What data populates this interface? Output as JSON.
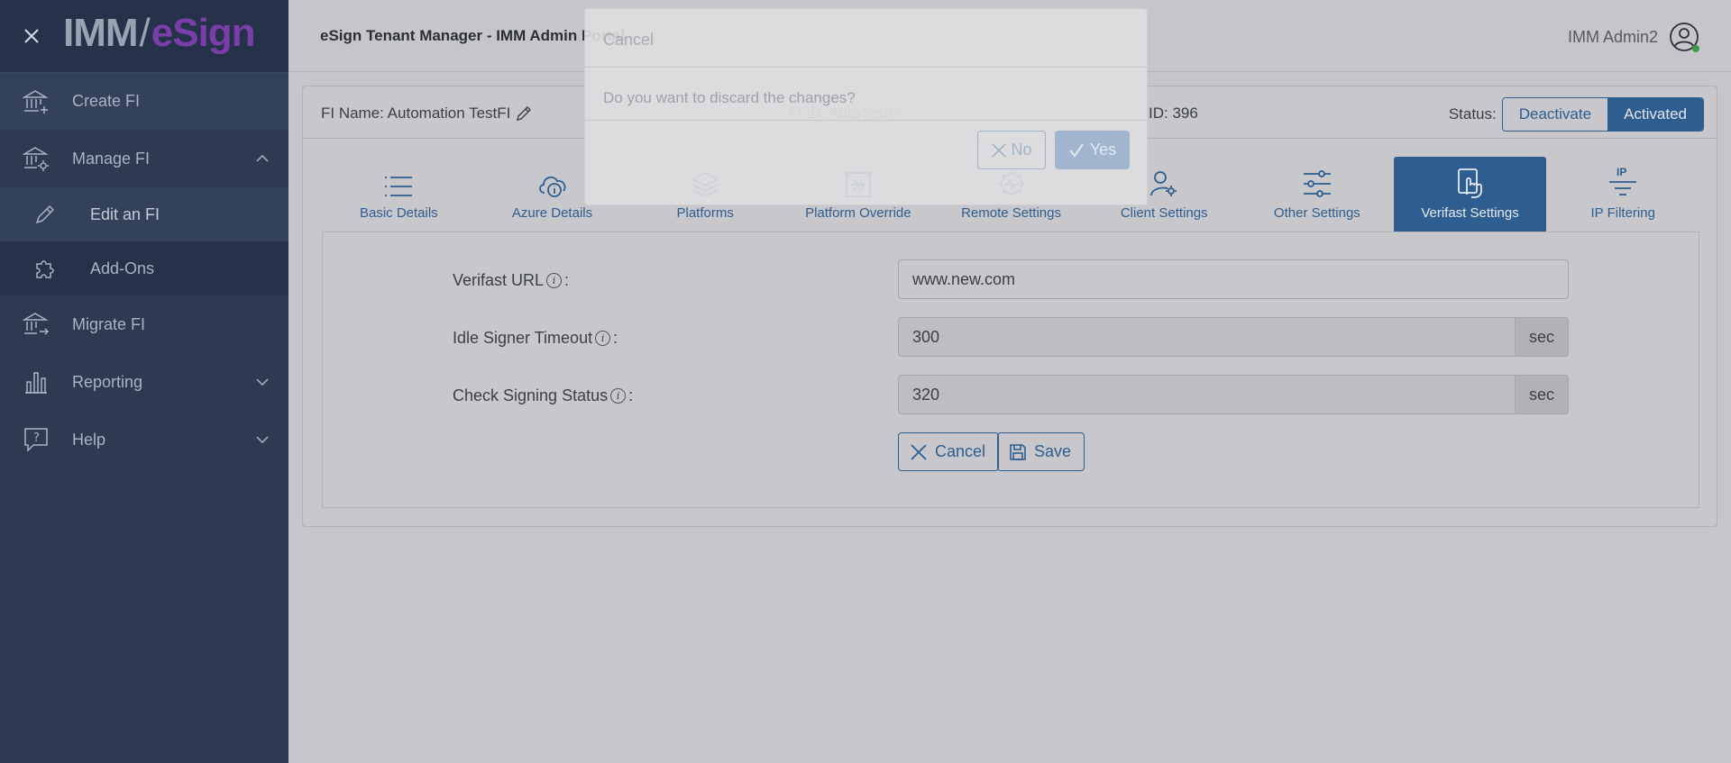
{
  "colors": {
    "sidebar_bg": "#2e3a52",
    "accent": "#2e5d8f",
    "logo_purple": "#7a3ea8"
  },
  "logo": {
    "part1": "IMM",
    "separator": "/",
    "part2": "eSign"
  },
  "sidebar": {
    "items": [
      {
        "label": "Create FI",
        "icon": "bank-plus-icon"
      },
      {
        "label": "Manage FI",
        "icon": "bank-gear-icon"
      },
      {
        "label": "Migrate FI",
        "icon": "bank-arrow-icon"
      },
      {
        "label": "Reporting",
        "icon": "bar-chart-icon"
      },
      {
        "label": "Help",
        "icon": "question-bubble-icon"
      }
    ],
    "sub_items": [
      {
        "label": "Edit an FI",
        "icon": "pencil-icon"
      },
      {
        "label": "Add-Ons",
        "icon": "puzzle-icon"
      }
    ]
  },
  "header": {
    "title": "eSign Tenant Manager - IMM Admin Portal",
    "user": "IMM Admin2"
  },
  "fi": {
    "name": "FI Name: Automation TestFI",
    "id": "FI ID: AutoTestFI",
    "num_id": "ID: 396",
    "status_label": "Status:",
    "deactivate": "Deactivate",
    "activated": "Activated"
  },
  "tabs": [
    {
      "label": "Basic Details",
      "icon": "list-icon"
    },
    {
      "label": "Azure Details",
      "icon": "cloud-info-icon"
    },
    {
      "label": "Platforms",
      "icon": "layers-icon"
    },
    {
      "label": "Platform Override",
      "icon": "arrow-box-icon"
    },
    {
      "label": "Remote Settings",
      "icon": "gear-pulse-icon"
    },
    {
      "label": "Client Settings",
      "icon": "user-gear-icon"
    },
    {
      "label": "Other Settings",
      "icon": "sliders-icon"
    },
    {
      "label": "Verifast Settings",
      "icon": "hand-touch-icon"
    },
    {
      "label": "IP Filtering",
      "icon": "ip-filter-icon",
      "icon_text": "IP"
    }
  ],
  "form": {
    "verifast_url": {
      "label": "Verifast URL",
      "colon": ":",
      "value": "www.new.com"
    },
    "idle_timeout": {
      "label": "Idle Signer Timeout",
      "colon": ":",
      "value": "300",
      "suffix": "sec"
    },
    "check_status": {
      "label": "Check Signing Status",
      "colon": ":",
      "value": "320",
      "suffix": "sec"
    },
    "cancel": "Cancel",
    "save": "Save"
  },
  "modal": {
    "title": "Cancel",
    "message": "Do you want to discard the changes?",
    "no": "No",
    "yes": "Yes"
  }
}
